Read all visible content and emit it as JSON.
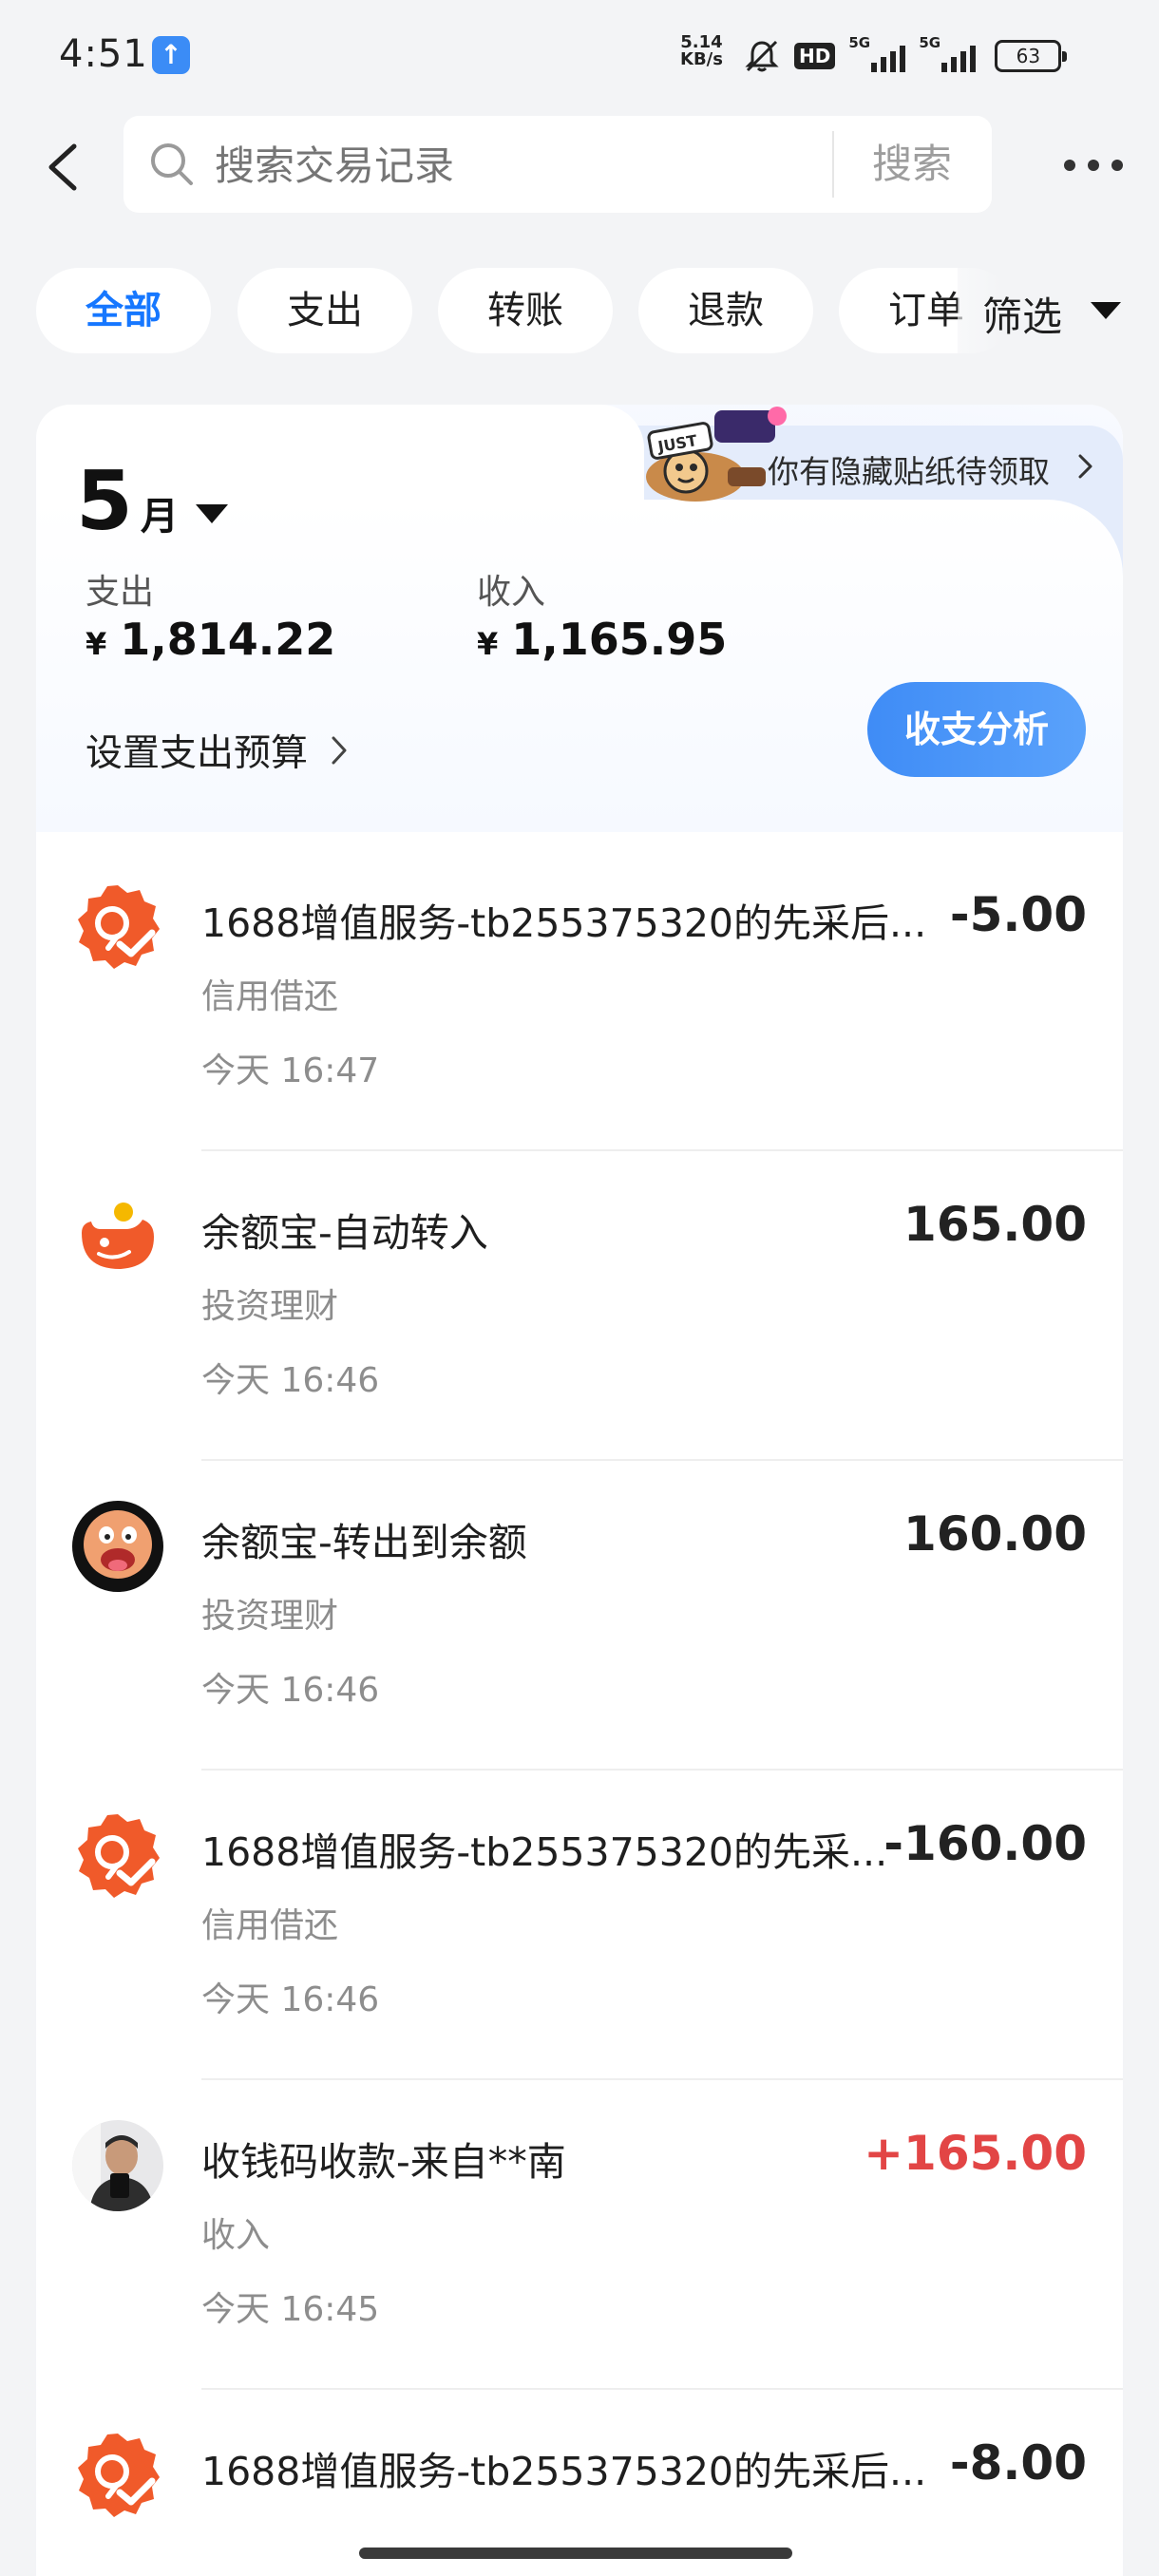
{
  "status_bar": {
    "time": "4:51",
    "net_speed_value": "5.14",
    "net_speed_unit": "KB/s",
    "hd_label": "HD",
    "signal_label_1": "5G",
    "signal_label_2": "5G",
    "battery": "63"
  },
  "search": {
    "placeholder": "搜索交易记录",
    "button_label": "搜索"
  },
  "tabs": [
    {
      "label": "全部",
      "active": true
    },
    {
      "label": "支出",
      "active": false
    },
    {
      "label": "转账",
      "active": false
    },
    {
      "label": "退款",
      "active": false
    },
    {
      "label": "订单",
      "active": false
    }
  ],
  "filter_label": "筛选",
  "summary": {
    "promo_text": "你有隐藏贴纸待领取",
    "month_number": "5",
    "month_unit": "月",
    "expense_label": "支出",
    "expense_currency": "¥",
    "expense_value": "1,814.22",
    "income_label": "收入",
    "income_currency": "¥",
    "income_value": "1,165.95",
    "budget_label": "设置支出预算",
    "analysis_button": "收支分析"
  },
  "transactions": [
    {
      "title": "1688增值服务-tb255375320的先采后...",
      "category": "信用借还",
      "time": "今天 16:47",
      "amount": "-5.00",
      "type": "expense",
      "icon": "credit-repay-icon"
    },
    {
      "title": "余额宝-自动转入",
      "category": "投资理财",
      "time": "今天 16:46",
      "amount": "165.00",
      "type": "neutral",
      "icon": "yuebao-icon"
    },
    {
      "title": "余额宝-转出到余额",
      "category": "投资理财",
      "time": "今天 16:46",
      "amount": "160.00",
      "type": "neutral",
      "icon": "avatar-cartoon-icon"
    },
    {
      "title": "1688增值服务-tb255375320的先采...",
      "category": "信用借还",
      "time": "今天 16:46",
      "amount": "-160.00",
      "type": "expense",
      "icon": "credit-repay-icon"
    },
    {
      "title": "收钱码收款-来自**南",
      "category": "收入",
      "time": "今天 16:45",
      "amount": "+165.00",
      "type": "income",
      "icon": "avatar-photo-icon"
    },
    {
      "title": "1688增值服务-tb255375320的先采后...",
      "category": "",
      "time": "",
      "amount": "-8.00",
      "type": "expense",
      "icon": "credit-repay-icon"
    }
  ],
  "colors": {
    "accent": "#1677ff",
    "income": "#e24545",
    "analysis_button": "#4a95f8",
    "credit_icon": "#f05a2a"
  }
}
